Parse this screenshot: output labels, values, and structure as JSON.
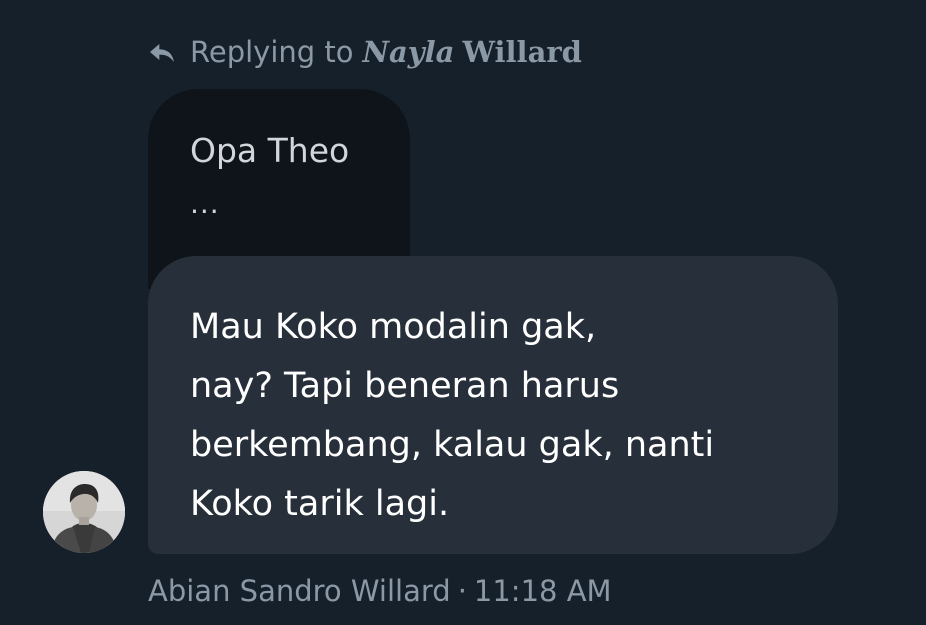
{
  "reply_header": {
    "prefix": "Replying to",
    "name_first": "Nayla",
    "name_last": "Willard",
    "icon": "reply-arrow-icon"
  },
  "quoted_message": {
    "name": "Opa Theo",
    "ellipsis": "..."
  },
  "message": {
    "lines": [
      "Mau Koko modalin gak,",
      "nay? Tapi beneran harus",
      "berkembang, kalau gak, nanti",
      "Koko tarik lagi."
    ]
  },
  "sender": {
    "name": "Abian Sandro Willard",
    "separator": "·",
    "time": "11:18 AM"
  },
  "colors": {
    "background": "#15202b",
    "bubble": "#27303a",
    "quoted_bubble": "#0f141a",
    "muted_text": "#8b98a5"
  }
}
